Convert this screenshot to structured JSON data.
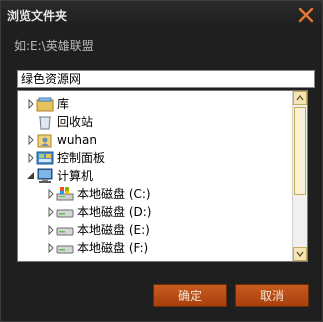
{
  "dialog": {
    "title": "浏览文件夹",
    "path_label": "如:E:\\英雄联盟",
    "folder_value": "绿色资源网",
    "ok_label": "确定",
    "cancel_label": "取消"
  },
  "tree": {
    "items": [
      {
        "label": "库",
        "icon": "library-icon"
      },
      {
        "label": "回收站",
        "icon": "recycle-bin-icon"
      },
      {
        "label": "wuhan",
        "icon": "user-folder-icon"
      },
      {
        "label": "控制面板",
        "icon": "control-panel-icon"
      },
      {
        "label": "计算机",
        "icon": "computer-icon"
      },
      {
        "label": "本地磁盘 (C:)",
        "icon": "drive-icon"
      },
      {
        "label": "本地磁盘 (D:)",
        "icon": "drive-icon"
      },
      {
        "label": "本地磁盘 (E:)",
        "icon": "drive-icon"
      },
      {
        "label": "本地磁盘 (F:)",
        "icon": "drive-icon"
      }
    ]
  },
  "colors": {
    "accent": "#b84e16",
    "scrollbar": "#f5e6b8"
  }
}
